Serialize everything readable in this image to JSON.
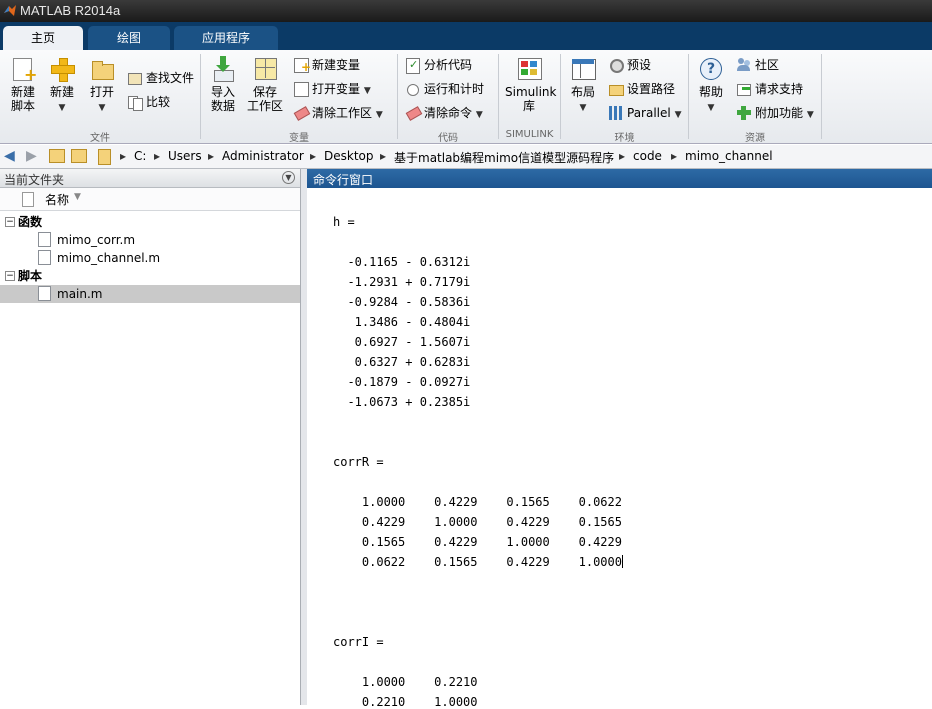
{
  "window": {
    "title": "MATLAB R2014a"
  },
  "tabs": [
    {
      "label": "主页",
      "active": true
    },
    {
      "label": "绘图",
      "active": false
    },
    {
      "label": "应用程序",
      "active": false
    }
  ],
  "ribbon": {
    "file": {
      "group_label": "文件",
      "new_script": "新建\n脚本",
      "new": "新建",
      "open": "打开",
      "find_files": "查找文件",
      "compare": "比较"
    },
    "variable": {
      "group_label": "变量",
      "import_data": "导入\n数据",
      "save_workspace": "保存\n工作区",
      "new_variable": "新建变量",
      "open_variable": "打开变量",
      "clear_workspace": "清除工作区"
    },
    "code": {
      "group_label": "代码",
      "analyze_code": "分析代码",
      "run_and_time": "运行和计时",
      "clear_commands": "清除命令"
    },
    "simulink": {
      "group_label": "SIMULINK",
      "library": "Simulink\n库"
    },
    "environment": {
      "group_label": "环境",
      "layout": "布局",
      "preferences": "预设",
      "set_path": "设置路径",
      "parallel": "Parallel"
    },
    "resources": {
      "group_label": "资源",
      "help": "帮助",
      "community": "社区",
      "request_support": "请求支持",
      "add_ons": "附加功能"
    }
  },
  "address": {
    "crumbs": [
      "C:",
      "Users",
      "Administrator",
      "Desktop",
      "基于matlab编程mimo信道模型源码程序",
      "code",
      "mimo_channel"
    ]
  },
  "current_folder": {
    "title": "当前文件夹",
    "column_name": "名称",
    "groups": [
      {
        "label": "函数",
        "files": [
          "mimo_corr.m",
          "mimo_channel.m"
        ]
      },
      {
        "label": "脚本",
        "files": [
          "main.m"
        ]
      }
    ],
    "selected_file": "main.m"
  },
  "command_window": {
    "title": "命令行窗口",
    "lines": [
      "h =",
      "",
      "  -0.1165 - 0.6312i",
      "  -1.2931 + 0.7179i",
      "  -0.9284 - 0.5836i",
      "   1.3486 - 0.4804i",
      "   0.6927 - 1.5607i",
      "   0.6327 + 0.6283i",
      "  -0.1879 - 0.0927i",
      "  -1.0673 + 0.2385i",
      "",
      "",
      "corrR =",
      "",
      "    1.0000    0.4229    0.1565    0.0622",
      "    0.4229    1.0000    0.4229    0.1565",
      "    0.1565    0.4229    1.0000    0.4229",
      "    0.0622    0.1565    0.4229    1.0000",
      "",
      "",
      "",
      "corrI =",
      "",
      "    1.0000    0.2210",
      "    0.2210    1.0000"
    ]
  }
}
